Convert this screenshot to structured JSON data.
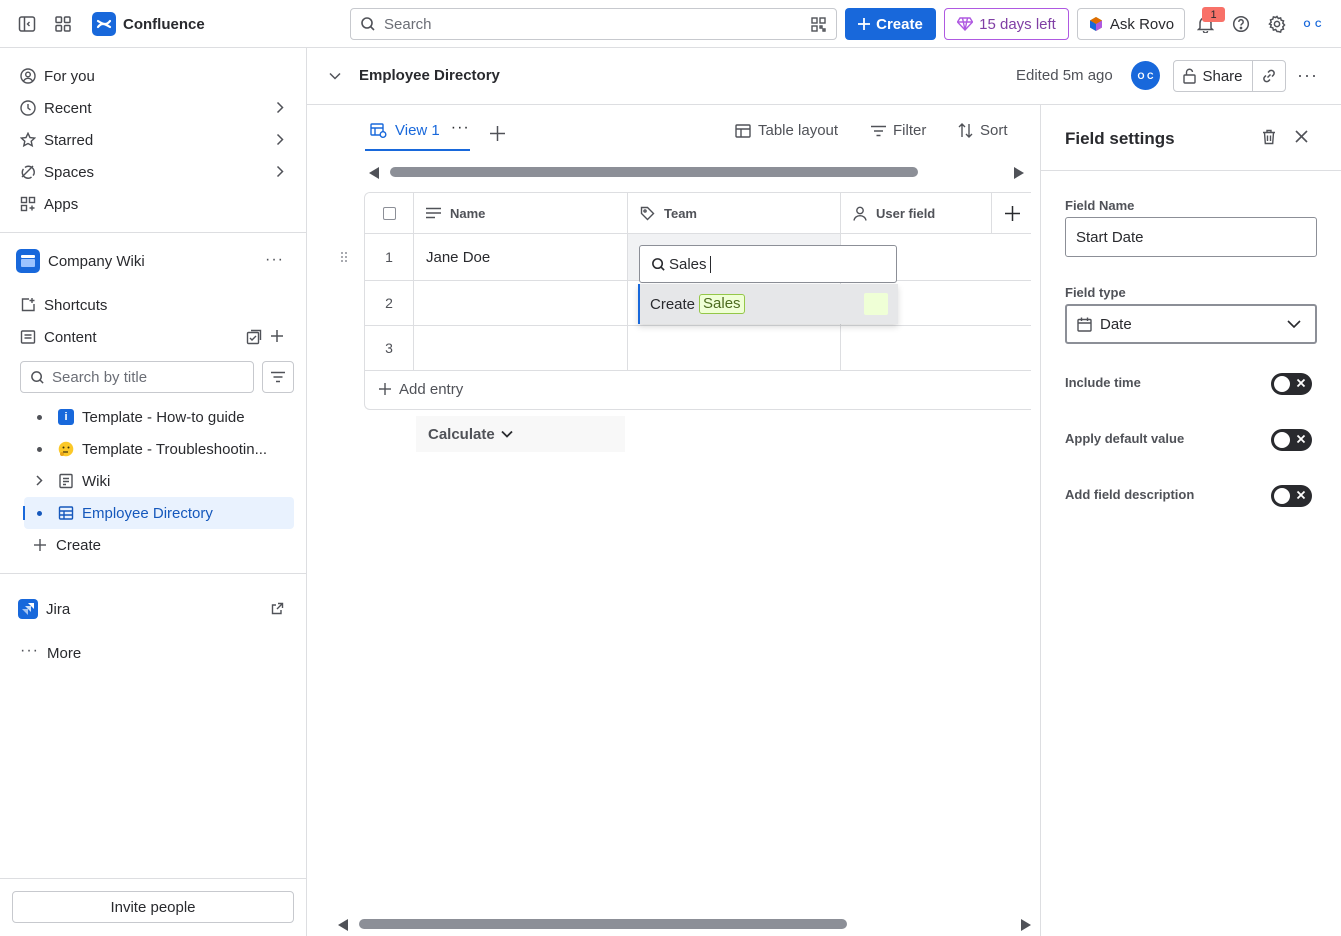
{
  "topbar": {
    "brand": "Confluence",
    "search_placeholder": "Search",
    "create_label": "Create",
    "trial_label": "15 days left",
    "rovo_label": "Ask Rovo",
    "notification_count": "1"
  },
  "sidebar": {
    "nav": [
      {
        "label": "For you"
      },
      {
        "label": "Recent"
      },
      {
        "label": "Starred"
      },
      {
        "label": "Spaces"
      },
      {
        "label": "Apps"
      }
    ],
    "space_name": "Company Wiki",
    "shortcuts_label": "Shortcuts",
    "content_label": "Content",
    "search_placeholder": "Search by title",
    "tree": [
      {
        "label": "Template - How-to guide"
      },
      {
        "label": "Template - Troubleshootin..."
      },
      {
        "label": "Wiki"
      },
      {
        "label": "Employee Directory"
      }
    ],
    "create_label": "Create",
    "jira_label": "Jira",
    "more_label": "More",
    "invite_label": "Invite people"
  },
  "page": {
    "title": "Employee Directory",
    "edited": "Edited 5m ago",
    "avatar_initials": "O C",
    "share_label": "Share"
  },
  "database": {
    "view_tab": "View 1",
    "layout_label": "Table layout",
    "filter_label": "Filter",
    "sort_label": "Sort",
    "columns": [
      {
        "label": "Name"
      },
      {
        "label": "Team"
      },
      {
        "label": "User field"
      }
    ],
    "rows": [
      {
        "num": "1",
        "name": "Jane Doe"
      },
      {
        "num": "2",
        "name": ""
      },
      {
        "num": "3",
        "name": ""
      }
    ],
    "add_entry_label": "Add entry",
    "calculate_label": "Calculate"
  },
  "dropdown": {
    "query": "Sales",
    "option_prefix": "Create",
    "option_chip": "Sales"
  },
  "field_settings": {
    "title": "Field settings",
    "field_name_label": "Field Name",
    "field_name_value": "Start Date",
    "field_type_label": "Field type",
    "field_type_value": "Date",
    "toggles": [
      {
        "label": "Include time",
        "on": false
      },
      {
        "label": "Apply default value",
        "on": false
      },
      {
        "label": "Add field description",
        "on": false
      }
    ]
  },
  "colors": {
    "accent": "#1868DB",
    "trial": "#803FA5",
    "chip_bg": "#EFFFD6",
    "badge": "#F87168"
  }
}
